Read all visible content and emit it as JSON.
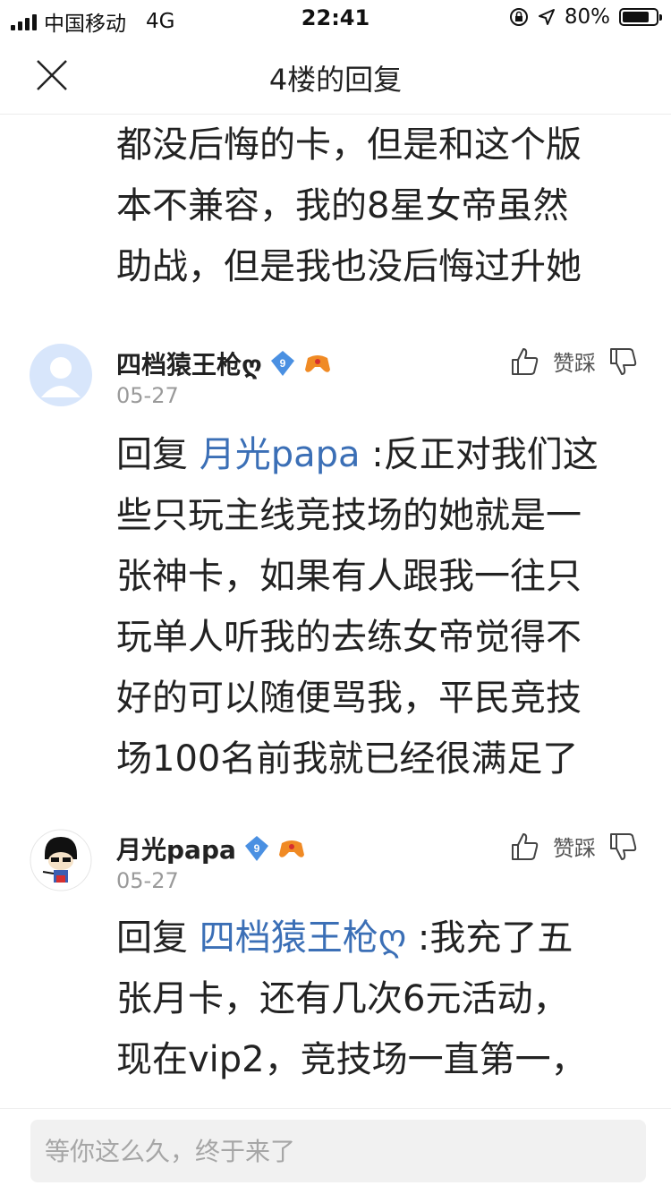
{
  "status_bar": {
    "carrier": "中国移动",
    "network": "4G",
    "time": "22:41",
    "battery": "80%",
    "battery_level": 0.8,
    "icons": [
      "signal-icon",
      "orientation-lock-icon",
      "location-icon",
      "battery-icon"
    ]
  },
  "nav": {
    "title": "4楼的回复",
    "close_icon": "close-icon"
  },
  "top_text": {
    "lines": [
      "都没后悔的卡，但是和这个版",
      "本不兼容，我的8星女帝虽然",
      "助战，但是我也没后悔过升她"
    ]
  },
  "replies": [
    {
      "username": "四档猿王枪ღ",
      "level": "9",
      "date": "05-27",
      "vote_label": "赞踩",
      "reply_prefix": "回复 ",
      "mention": "月光papa",
      "content_first": " :反正对我们这",
      "content_lines": [
        "些只玩主线竞技场的她就是一",
        "张神卡，如果有人跟我一往只",
        "玩单人听我的去练女帝觉得不",
        "好的可以随便骂我，平民竞技",
        "场100名前我就已经很满足了"
      ]
    },
    {
      "username": "月光papa",
      "level": "9",
      "date": "05-27",
      "vote_label": "赞踩",
      "reply_prefix": "回复 ",
      "mention": "四档猿王枪ღ",
      "content_first": " :我充了五",
      "content_lines": [
        "张月卡，还有几次6元活动，",
        "现在vip2，竞技场一直第一，"
      ]
    }
  ],
  "input": {
    "placeholder": "等你这么久，终于来了"
  },
  "colors": {
    "mention": "#3b6fb6",
    "badge_blue": "#4a90e2",
    "badge_orange": "#f08a24",
    "date_gray": "#9a9a9a"
  }
}
